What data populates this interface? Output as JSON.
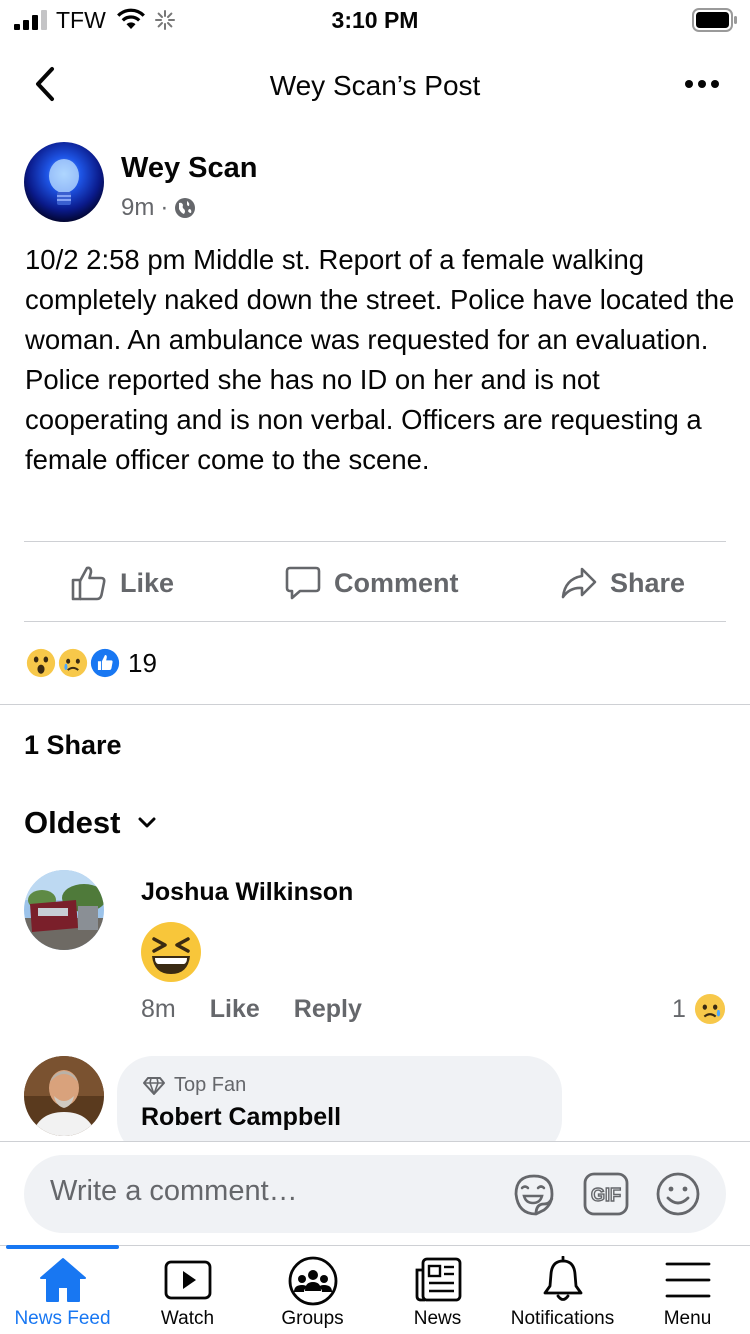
{
  "status_bar": {
    "carrier": "TFW",
    "time": "3:10 PM"
  },
  "nav": {
    "title": "Wey Scan’s Post",
    "back_icon": "chevron-left-icon",
    "more_icon": "more-icon"
  },
  "post": {
    "author": "Wey Scan",
    "time": "9m",
    "separator": "·",
    "privacy_icon": "globe-icon",
    "text": "10/2 2:58 pm Middle st. Report of a female walking completely naked down the street.  Police have located the woman. An ambulance was requested for an evaluation. Police reported she has no ID on her and is not cooperating and is non verbal. Officers are requesting a female officer come to the scene."
  },
  "actions": {
    "like": "Like",
    "comment": "Comment",
    "share": "Share"
  },
  "reactions": {
    "count": "19",
    "types": [
      "wow",
      "sad",
      "like"
    ]
  },
  "shares": {
    "label": "1 Share"
  },
  "sort": {
    "label": "Oldest"
  },
  "comments": [
    {
      "name": "Joshua Wilkinson",
      "content_emoji": "laughing-squint-emoji",
      "time": "8m",
      "like": "Like",
      "reply": "Reply",
      "reaction_count": "1",
      "reaction_type": "sad"
    },
    {
      "badge": "Top Fan",
      "name": "Robert Campbell"
    }
  ],
  "composer": {
    "placeholder": "Write a comment…"
  },
  "tabs": [
    {
      "label": "News Feed",
      "icon": "home-icon",
      "active": true
    },
    {
      "label": "Watch",
      "icon": "watch-icon"
    },
    {
      "label": "Groups",
      "icon": "groups-icon"
    },
    {
      "label": "News",
      "icon": "news-icon"
    },
    {
      "label": "Notifications",
      "icon": "bell-icon"
    },
    {
      "label": "Menu",
      "icon": "menu-icon"
    }
  ],
  "colors": {
    "brand": "#1877f2",
    "secondary_text": "#65676b",
    "divider": "#ced0d4",
    "bubble": "#f0f2f5"
  }
}
